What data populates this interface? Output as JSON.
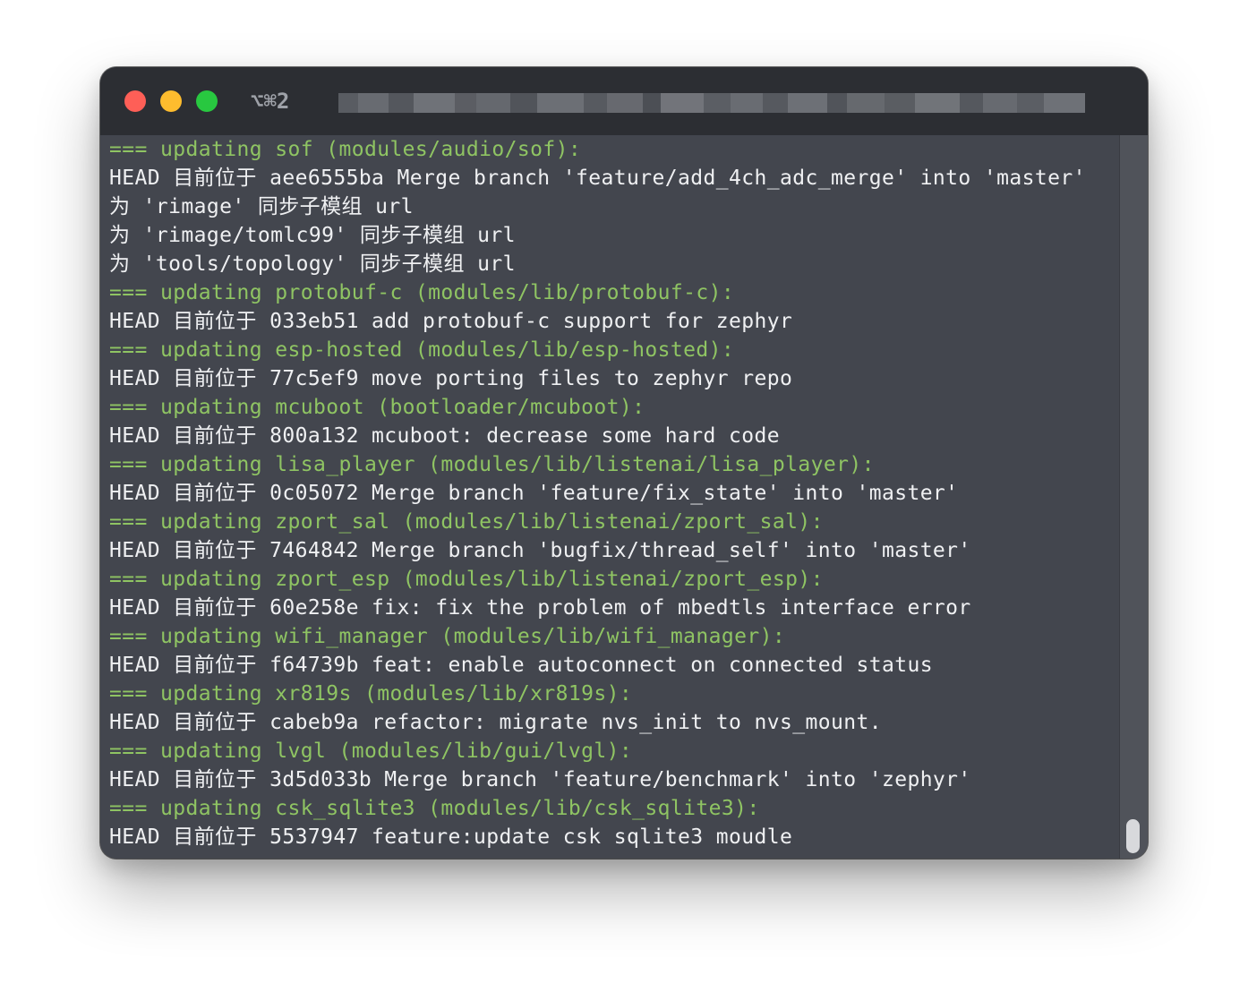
{
  "window": {
    "tab_shortcut": "⌥⌘2",
    "lights": [
      "close",
      "minimize",
      "zoom"
    ]
  },
  "colors": {
    "section_text": "#8fc463",
    "plain_text": "#eff0f2",
    "background": "#43464e",
    "titlebar": "#2c2e33"
  },
  "terminal": {
    "lines": [
      {
        "kind": "section",
        "text": "=== updating sof (modules/audio/sof):"
      },
      {
        "kind": "plain",
        "text": "HEAD 目前位于 aee6555ba Merge branch 'feature/add_4ch_adc_merge' into 'master'"
      },
      {
        "kind": "plain",
        "text": "为 'rimage' 同步子模组 url"
      },
      {
        "kind": "plain",
        "text": "为 'rimage/tomlc99' 同步子模组 url"
      },
      {
        "kind": "plain",
        "text": "为 'tools/topology' 同步子模组 url"
      },
      {
        "kind": "section",
        "text": "=== updating protobuf-c (modules/lib/protobuf-c):"
      },
      {
        "kind": "plain",
        "text": "HEAD 目前位于 033eb51 add protobuf-c support for zephyr"
      },
      {
        "kind": "section",
        "text": "=== updating esp-hosted (modules/lib/esp-hosted):"
      },
      {
        "kind": "plain",
        "text": "HEAD 目前位于 77c5ef9 move porting files to zephyr repo"
      },
      {
        "kind": "section",
        "text": "=== updating mcuboot (bootloader/mcuboot):"
      },
      {
        "kind": "plain",
        "text": "HEAD 目前位于 800a132 mcuboot: decrease some hard code"
      },
      {
        "kind": "section",
        "text": "=== updating lisa_player (modules/lib/listenai/lisa_player):"
      },
      {
        "kind": "plain",
        "text": "HEAD 目前位于 0c05072 Merge branch 'feature/fix_state' into 'master'"
      },
      {
        "kind": "section",
        "text": "=== updating zport_sal (modules/lib/listenai/zport_sal):"
      },
      {
        "kind": "plain",
        "text": "HEAD 目前位于 7464842 Merge branch 'bugfix/thread_self' into 'master'"
      },
      {
        "kind": "section",
        "text": "=== updating zport_esp (modules/lib/listenai/zport_esp):"
      },
      {
        "kind": "plain",
        "text": "HEAD 目前位于 60e258e fix: fix the problem of mbedtls interface error"
      },
      {
        "kind": "section",
        "text": "=== updating wifi_manager (modules/lib/wifi_manager):"
      },
      {
        "kind": "plain",
        "text": "HEAD 目前位于 f64739b feat: enable autoconnect on connected status"
      },
      {
        "kind": "section",
        "text": "=== updating xr819s (modules/lib/xr819s):"
      },
      {
        "kind": "plain",
        "text": "HEAD 目前位于 cabeb9a refactor: migrate nvs_init to nvs_mount."
      },
      {
        "kind": "section",
        "text": "=== updating lvgl (modules/lib/gui/lvgl):"
      },
      {
        "kind": "plain",
        "text": "HEAD 目前位于 3d5d033b Merge branch 'feature/benchmark' into 'zephyr'"
      },
      {
        "kind": "section",
        "text": "=== updating csk_sqlite3 (modules/lib/csk_sqlite3):"
      },
      {
        "kind": "plain",
        "text": "HEAD 目前位于 5537947 feature:update csk sqlite3 moudle"
      }
    ]
  }
}
